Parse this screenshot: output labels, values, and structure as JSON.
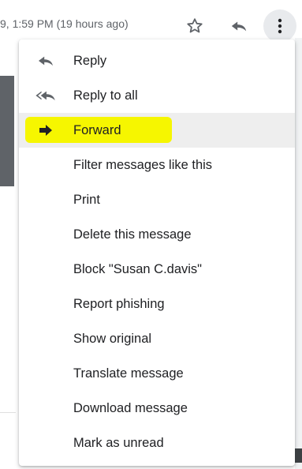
{
  "header": {
    "timestamp": "9, 1:59 PM (19 hours ago)",
    "icons": {
      "star": "star-outline-icon",
      "reply": "reply-arrow-icon",
      "more": "more-vert-icon"
    }
  },
  "menu": {
    "items": [
      {
        "label": "Reply",
        "icon": "reply-icon"
      },
      {
        "label": "Reply to all",
        "icon": "reply-all-icon"
      },
      {
        "label": "Forward",
        "icon": "forward-arrow-icon",
        "highlighted": true,
        "highlight_color": "#f6f600"
      },
      {
        "label": "Filter messages like this"
      },
      {
        "label": "Print"
      },
      {
        "label": "Delete this message"
      },
      {
        "label": "Block \"Susan C.davis\""
      },
      {
        "label": "Report phishing"
      },
      {
        "label": "Show original"
      },
      {
        "label": "Translate message"
      },
      {
        "label": "Download message"
      },
      {
        "label": "Mark as unread"
      }
    ]
  },
  "colors": {
    "text": "#202124",
    "muted_text": "#5f6368",
    "icon": "#5f6368",
    "forward_icon": "#202124",
    "hover_bg": "#eeeeee",
    "highlight": "#f6f600"
  }
}
